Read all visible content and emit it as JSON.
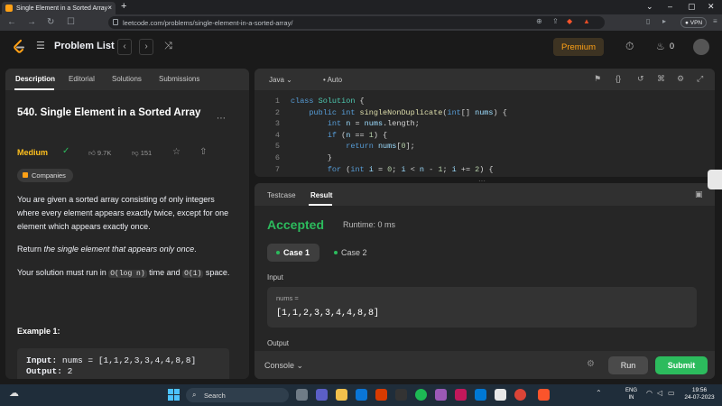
{
  "browser": {
    "tab_title": "Single Element in a Sorted Array",
    "tab_close": "×",
    "new_tab": "+",
    "url": "leetcode.com/problems/single-element-in-a-sorted-array/",
    "vpn": "● VPN",
    "nav_back": "←",
    "nav_forward": "→",
    "nav_reload": "↻"
  },
  "navbar": {
    "problem_list": "Problem List",
    "prev": "‹",
    "next": "›",
    "shuffle": "⤨",
    "premium": "Premium",
    "points": "0"
  },
  "description": {
    "tabs": [
      "Description",
      "Editorial",
      "Solutions",
      "Submissions"
    ],
    "title": "540. Single Element in a Sorted Array",
    "difficulty": "Medium",
    "likes": "9.7K",
    "dislikes": "151",
    "companies": "Companies",
    "para1": "You are given a sorted array consisting of only integers where every element appears exactly twice, except for one element which appears exactly once.",
    "para2_prefix": "Return ",
    "para2_em": "the single element that appears only once",
    "para2_suffix": ".",
    "para3_a": "Your solution must run in ",
    "para3_code1": "O(log n)",
    "para3_b": " time and ",
    "para3_code2": "O(1)",
    "para3_c": " space.",
    "example_title": "Example 1:",
    "example_input_label": "Input:",
    "example_input_value": "nums = [1,1,2,3,3,4,4,8,8]",
    "example_output_label": "Output:",
    "example_output_value": "2"
  },
  "editor": {
    "language": "Java",
    "mode": "Auto",
    "lines": [
      {
        "n": "1",
        "code": "class Solution {"
      },
      {
        "n": "2",
        "code": "    public int singleNonDuplicate(int[] nums) {"
      },
      {
        "n": "3",
        "code": "        int n = nums.length;"
      },
      {
        "n": "4",
        "code": "        if (n == 1) {"
      },
      {
        "n": "5",
        "code": "            return nums[0];"
      },
      {
        "n": "6",
        "code": "        }"
      },
      {
        "n": "7",
        "code": "        for (int i = 0; i < n - 1; i += 2) {"
      }
    ]
  },
  "result": {
    "tabs": [
      "Testcase",
      "Result"
    ],
    "status": "Accepted",
    "runtime": "Runtime: 0 ms",
    "cases": [
      "Case 1",
      "Case 2"
    ],
    "input_label": "Input",
    "var_name": "nums =",
    "var_value": "[1,1,2,3,3,4,4,8,8]",
    "output_label": "Output",
    "console": "Console",
    "run": "Run",
    "submit": "Submit"
  },
  "taskbar": {
    "search": "Search",
    "lang_line1": "ENG",
    "lang_line2": "IN",
    "time": "19:56",
    "date": "24-07-2023"
  },
  "colors": {
    "accent": "#ffa116",
    "accepted": "#2cbb5d",
    "medium": "#ffc01e"
  }
}
